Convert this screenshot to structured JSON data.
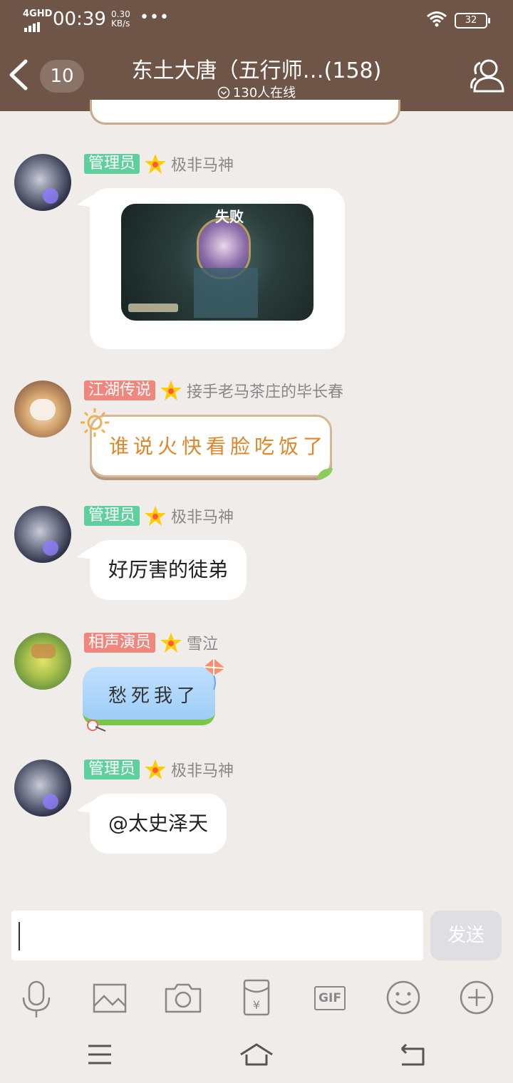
{
  "status": {
    "network": "4GHD",
    "time": "00:39",
    "speed_value": "0.30",
    "speed_unit": "KB/s",
    "more": "•••",
    "battery": "32"
  },
  "header": {
    "unread_count": "10",
    "title": "东土大唐（五行师…(158)",
    "online": "130人在线"
  },
  "messages": [
    {
      "badge": "管理员",
      "badge_color": "#5fcf9e",
      "nickname": "极非马神",
      "type": "image",
      "image_text": "失败"
    },
    {
      "badge": "江湖传说",
      "badge_color": "#f0877f",
      "nickname": "接手老马茶庄的毕长春",
      "type": "styled-text",
      "text": "谁说火快看脸吃饭了"
    },
    {
      "badge": "管理员",
      "badge_color": "#5fcf9e",
      "nickname": "极非马神",
      "type": "text",
      "text": "好厉害的徒弟"
    },
    {
      "badge": "相声演员",
      "badge_color": "#f0877f",
      "nickname": "雪泣",
      "type": "styled-text",
      "text": "愁死我了"
    },
    {
      "badge": "管理员",
      "badge_color": "#5fcf9e",
      "nickname": "极非马神",
      "type": "text",
      "text": "@太史泽天"
    }
  ],
  "input": {
    "send_label": "发送"
  },
  "toolbar": {
    "icons": [
      "microphone-icon",
      "image-icon",
      "camera-icon",
      "red-packet-icon",
      "gif-icon",
      "emoji-icon",
      "plus-icon"
    ],
    "gif_label": "GIF"
  }
}
